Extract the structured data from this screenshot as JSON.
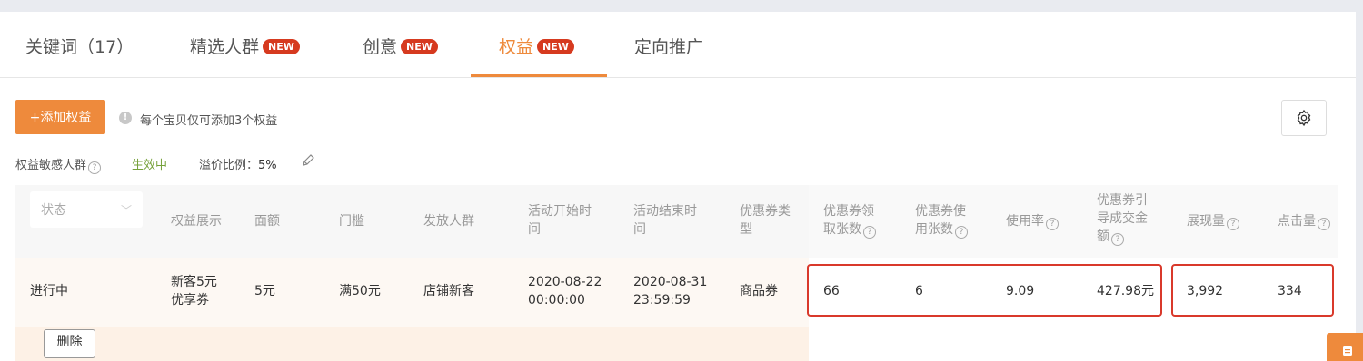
{
  "tabs": [
    {
      "label": "关键词（17）"
    },
    {
      "label": "精选人群",
      "badge": "NEW"
    },
    {
      "label": "创意",
      "badge": "NEW"
    },
    {
      "label": "权益",
      "badge": "NEW",
      "active": true
    },
    {
      "label": "定向推广"
    }
  ],
  "toolbar": {
    "add_label": "+添加权益",
    "info_text": "每个宝贝仅可添加3个权益",
    "info_icon": "exclamation-icon",
    "settings_icon": "gear-icon"
  },
  "sensitivity": {
    "label": "权益敏感人群",
    "help": "?",
    "status": "生效中",
    "premium_label": "溢价比例：",
    "premium_value": "5%",
    "edit_icon": "pencil-icon"
  },
  "table": {
    "status_placeholder": "状态",
    "headers": {
      "display": "权益展示",
      "amount": "面额",
      "threshold": "门槛",
      "audience": "发放人群",
      "start_line1": "活动开始时",
      "start_line2": "间",
      "end_line1": "活动结束时",
      "end_line2": "间",
      "type_line1": "优惠券类",
      "type_line2": "型",
      "claimed_line1": "优惠券领",
      "claimed_line2": "取张数",
      "used_line1": "优惠券使",
      "used_line2": "用张数",
      "usage_rate": "使用率",
      "gmv_line1": "优惠券引",
      "gmv_line2": "导成交金",
      "gmv_line3": "额",
      "impressions": "展现量",
      "clicks": "点击量"
    },
    "row": {
      "status": "进行中",
      "display_line1": "新客5元",
      "display_line2": "优享券",
      "amount": "5元",
      "threshold": "满50元",
      "audience": "店铺新客",
      "start_date": "2020-08-22",
      "start_time": "00:00:00",
      "end_date": "2020-08-31",
      "end_time": "23:59:59",
      "type": "商品券",
      "claimed": "66",
      "used": "6",
      "usage_rate": "9.09",
      "gmv": "427.98元",
      "impressions": "3,992",
      "clicks": "334"
    },
    "delete_label": "删除"
  },
  "colors": {
    "accent": "#ee8a3c",
    "badge": "#d63a1f",
    "active_status": "#76a13b",
    "highlight_box": "#d9392b"
  }
}
